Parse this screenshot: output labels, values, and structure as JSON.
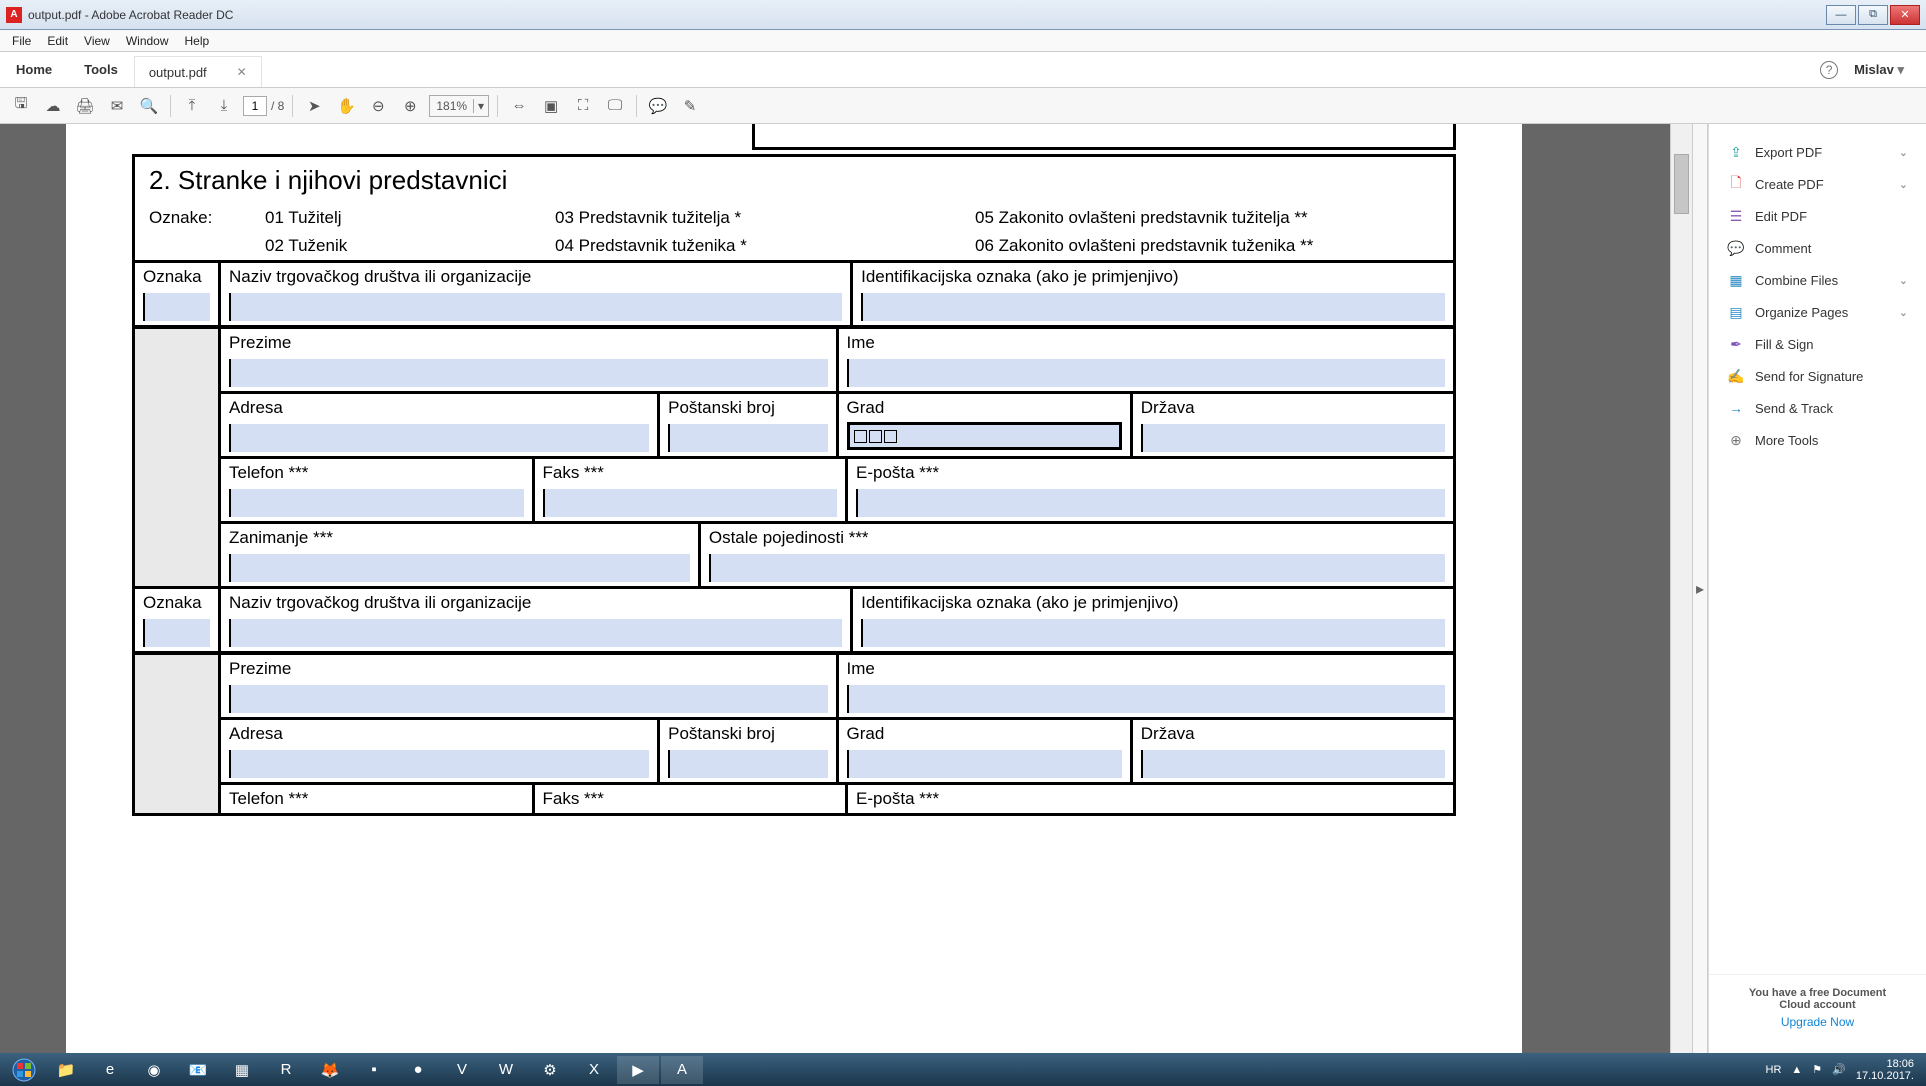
{
  "window": {
    "title": "output.pdf - Adobe Acrobat Reader DC"
  },
  "menu": {
    "file": "File",
    "edit": "Edit",
    "view": "View",
    "window": "Window",
    "help": "Help"
  },
  "tabs": {
    "home": "Home",
    "tools": "Tools",
    "doc": "output.pdf"
  },
  "toolbar": {
    "page_current": "1",
    "page_total": "/ 8",
    "zoom": "181%"
  },
  "user": {
    "name": "Mislav",
    "help_tip": "?"
  },
  "right_panel": {
    "items": [
      {
        "label": "Export PDF",
        "color": "c-teal",
        "icon": "⇪",
        "chev": true
      },
      {
        "label": "Create PDF",
        "color": "c-red",
        "icon": "🗋",
        "chev": true
      },
      {
        "label": "Edit PDF",
        "color": "c-purple",
        "icon": "✎",
        "chev": false
      },
      {
        "label": "Comment",
        "color": "c-yellow",
        "icon": "💬",
        "chev": false
      },
      {
        "label": "Combine Files",
        "color": "c-blue",
        "icon": "▦",
        "chev": true
      },
      {
        "label": "Organize Pages",
        "color": "c-blue",
        "icon": "▤",
        "chev": true
      },
      {
        "label": "Fill & Sign",
        "color": "c-violet",
        "icon": "✒",
        "chev": false
      },
      {
        "label": "Send for Signature",
        "color": "c-red",
        "icon": "✍",
        "chev": false
      },
      {
        "label": "Send & Track",
        "color": "c-blue",
        "icon": "→",
        "chev": false
      },
      {
        "label": "More Tools",
        "color": "c-gray",
        "icon": "⊕",
        "chev": false
      }
    ],
    "footer1": "You have a free Document",
    "footer2": "Cloud account",
    "upgrade": "Upgrade Now"
  },
  "form": {
    "title": "2. Stranke i njihovi predstavnici",
    "legend_label": "Oznake:",
    "legend": [
      {
        "a": "01 Tužitelj",
        "b": "03 Predstavnik tužitelja *",
        "c": "05 Zakonito ovlašteni predstavnik tužitelja **"
      },
      {
        "a": "02 Tuženik",
        "b": "04 Predstavnik tuženika *",
        "c": "06 Zakonito ovlašteni predstavnik tuženika **"
      }
    ],
    "labels": {
      "oznaka": "Oznaka",
      "naziv": "Naziv trgovačkog društva ili organizacije",
      "ident": "Identifikacijska oznaka (ako je primjenjivo)",
      "prezime": "Prezime",
      "ime": "Ime",
      "adresa": "Adresa",
      "postanski": "Poštanski broj",
      "grad": "Grad",
      "drzava": "Država",
      "telefon": "Telefon ***",
      "faks": "Faks ***",
      "eposta": "E-pošta ***",
      "zanimanje": "Zanimanje ***",
      "ostale": "Ostale pojedinosti ***"
    }
  },
  "tray": {
    "lang": "HR",
    "time": "18:06",
    "date": "17.10.2017."
  }
}
